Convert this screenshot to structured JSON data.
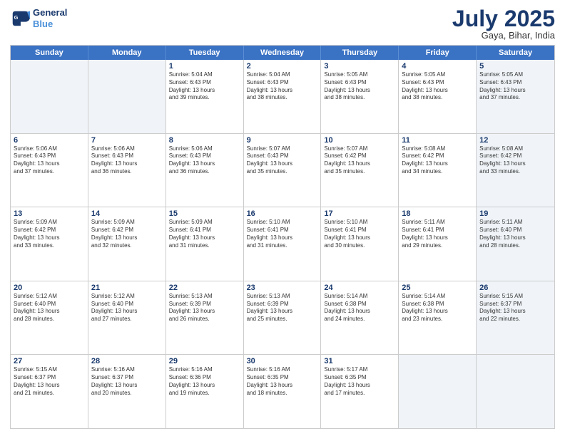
{
  "header": {
    "logo_line1": "General",
    "logo_line2": "Blue",
    "month": "July 2025",
    "location": "Gaya, Bihar, India"
  },
  "days_of_week": [
    "Sunday",
    "Monday",
    "Tuesday",
    "Wednesday",
    "Thursday",
    "Friday",
    "Saturday"
  ],
  "weeks": [
    [
      {
        "day": "",
        "info": "",
        "shaded": true
      },
      {
        "day": "",
        "info": "",
        "shaded": true
      },
      {
        "day": "1",
        "info": "Sunrise: 5:04 AM\nSunset: 6:43 PM\nDaylight: 13 hours\nand 39 minutes.",
        "shaded": false
      },
      {
        "day": "2",
        "info": "Sunrise: 5:04 AM\nSunset: 6:43 PM\nDaylight: 13 hours\nand 38 minutes.",
        "shaded": false
      },
      {
        "day": "3",
        "info": "Sunrise: 5:05 AM\nSunset: 6:43 PM\nDaylight: 13 hours\nand 38 minutes.",
        "shaded": false
      },
      {
        "day": "4",
        "info": "Sunrise: 5:05 AM\nSunset: 6:43 PM\nDaylight: 13 hours\nand 38 minutes.",
        "shaded": false
      },
      {
        "day": "5",
        "info": "Sunrise: 5:05 AM\nSunset: 6:43 PM\nDaylight: 13 hours\nand 37 minutes.",
        "shaded": true
      }
    ],
    [
      {
        "day": "6",
        "info": "Sunrise: 5:06 AM\nSunset: 6:43 PM\nDaylight: 13 hours\nand 37 minutes.",
        "shaded": false
      },
      {
        "day": "7",
        "info": "Sunrise: 5:06 AM\nSunset: 6:43 PM\nDaylight: 13 hours\nand 36 minutes.",
        "shaded": false
      },
      {
        "day": "8",
        "info": "Sunrise: 5:06 AM\nSunset: 6:43 PM\nDaylight: 13 hours\nand 36 minutes.",
        "shaded": false
      },
      {
        "day": "9",
        "info": "Sunrise: 5:07 AM\nSunset: 6:43 PM\nDaylight: 13 hours\nand 35 minutes.",
        "shaded": false
      },
      {
        "day": "10",
        "info": "Sunrise: 5:07 AM\nSunset: 6:42 PM\nDaylight: 13 hours\nand 35 minutes.",
        "shaded": false
      },
      {
        "day": "11",
        "info": "Sunrise: 5:08 AM\nSunset: 6:42 PM\nDaylight: 13 hours\nand 34 minutes.",
        "shaded": false
      },
      {
        "day": "12",
        "info": "Sunrise: 5:08 AM\nSunset: 6:42 PM\nDaylight: 13 hours\nand 33 minutes.",
        "shaded": true
      }
    ],
    [
      {
        "day": "13",
        "info": "Sunrise: 5:09 AM\nSunset: 6:42 PM\nDaylight: 13 hours\nand 33 minutes.",
        "shaded": false
      },
      {
        "day": "14",
        "info": "Sunrise: 5:09 AM\nSunset: 6:42 PM\nDaylight: 13 hours\nand 32 minutes.",
        "shaded": false
      },
      {
        "day": "15",
        "info": "Sunrise: 5:09 AM\nSunset: 6:41 PM\nDaylight: 13 hours\nand 31 minutes.",
        "shaded": false
      },
      {
        "day": "16",
        "info": "Sunrise: 5:10 AM\nSunset: 6:41 PM\nDaylight: 13 hours\nand 31 minutes.",
        "shaded": false
      },
      {
        "day": "17",
        "info": "Sunrise: 5:10 AM\nSunset: 6:41 PM\nDaylight: 13 hours\nand 30 minutes.",
        "shaded": false
      },
      {
        "day": "18",
        "info": "Sunrise: 5:11 AM\nSunset: 6:41 PM\nDaylight: 13 hours\nand 29 minutes.",
        "shaded": false
      },
      {
        "day": "19",
        "info": "Sunrise: 5:11 AM\nSunset: 6:40 PM\nDaylight: 13 hours\nand 28 minutes.",
        "shaded": true
      }
    ],
    [
      {
        "day": "20",
        "info": "Sunrise: 5:12 AM\nSunset: 6:40 PM\nDaylight: 13 hours\nand 28 minutes.",
        "shaded": false
      },
      {
        "day": "21",
        "info": "Sunrise: 5:12 AM\nSunset: 6:40 PM\nDaylight: 13 hours\nand 27 minutes.",
        "shaded": false
      },
      {
        "day": "22",
        "info": "Sunrise: 5:13 AM\nSunset: 6:39 PM\nDaylight: 13 hours\nand 26 minutes.",
        "shaded": false
      },
      {
        "day": "23",
        "info": "Sunrise: 5:13 AM\nSunset: 6:39 PM\nDaylight: 13 hours\nand 25 minutes.",
        "shaded": false
      },
      {
        "day": "24",
        "info": "Sunrise: 5:14 AM\nSunset: 6:38 PM\nDaylight: 13 hours\nand 24 minutes.",
        "shaded": false
      },
      {
        "day": "25",
        "info": "Sunrise: 5:14 AM\nSunset: 6:38 PM\nDaylight: 13 hours\nand 23 minutes.",
        "shaded": false
      },
      {
        "day": "26",
        "info": "Sunrise: 5:15 AM\nSunset: 6:37 PM\nDaylight: 13 hours\nand 22 minutes.",
        "shaded": true
      }
    ],
    [
      {
        "day": "27",
        "info": "Sunrise: 5:15 AM\nSunset: 6:37 PM\nDaylight: 13 hours\nand 21 minutes.",
        "shaded": false
      },
      {
        "day": "28",
        "info": "Sunrise: 5:16 AM\nSunset: 6:37 PM\nDaylight: 13 hours\nand 20 minutes.",
        "shaded": false
      },
      {
        "day": "29",
        "info": "Sunrise: 5:16 AM\nSunset: 6:36 PM\nDaylight: 13 hours\nand 19 minutes.",
        "shaded": false
      },
      {
        "day": "30",
        "info": "Sunrise: 5:16 AM\nSunset: 6:35 PM\nDaylight: 13 hours\nand 18 minutes.",
        "shaded": false
      },
      {
        "day": "31",
        "info": "Sunrise: 5:17 AM\nSunset: 6:35 PM\nDaylight: 13 hours\nand 17 minutes.",
        "shaded": false
      },
      {
        "day": "",
        "info": "",
        "shaded": true
      },
      {
        "day": "",
        "info": "",
        "shaded": true
      }
    ]
  ]
}
